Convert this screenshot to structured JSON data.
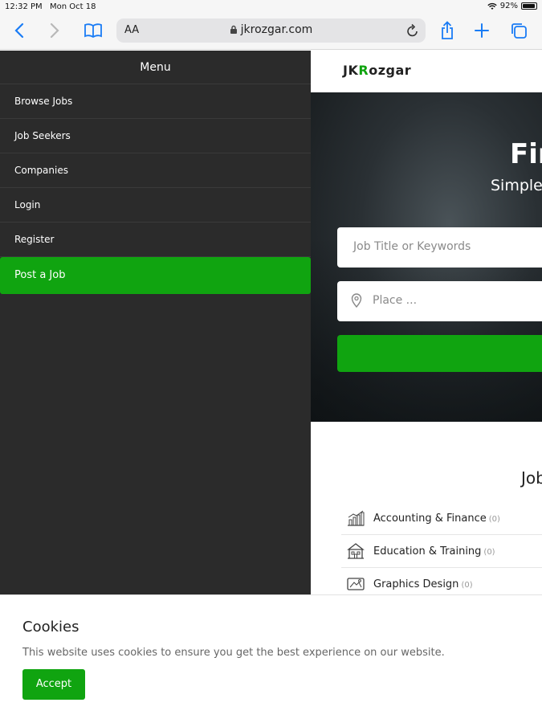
{
  "status_bar": {
    "time": "12:32 PM",
    "date": "Mon Oct 18",
    "battery": "92%"
  },
  "browser": {
    "text_size_label": "AA",
    "url": "jkrozgar.com"
  },
  "site": {
    "logo_prefix": "JK",
    "logo_letter": "R",
    "logo_accent": "o",
    "logo_suffix": "zgar",
    "hero_title": "Fin",
    "hero_subtitle": "Simple",
    "keyword_placeholder": "Job Title or Keywords",
    "place_placeholder": "Place ...",
    "section_title": "Job",
    "categories": [
      {
        "name": "Accounting & Finance",
        "count": "(0)",
        "icon": "chart-icon"
      },
      {
        "name": "Education & Training",
        "count": "(0)",
        "icon": "school-icon"
      },
      {
        "name": "Graphics Design",
        "count": "(0)",
        "icon": "design-icon"
      }
    ]
  },
  "menu": {
    "title": "Menu",
    "items": [
      {
        "label": "Browse Jobs"
      },
      {
        "label": "Job Seekers"
      },
      {
        "label": "Companies"
      },
      {
        "label": "Login"
      },
      {
        "label": "Register"
      },
      {
        "label": "Post a Job"
      }
    ]
  },
  "cookies": {
    "title": "Cookies",
    "text": "This website uses cookies to ensure you get the best experience on our website.",
    "accept_label": "Accept"
  },
  "colors": {
    "accent": "#10a410",
    "menu_bg": "#2b2b2b",
    "link": "#1a7cf5"
  }
}
